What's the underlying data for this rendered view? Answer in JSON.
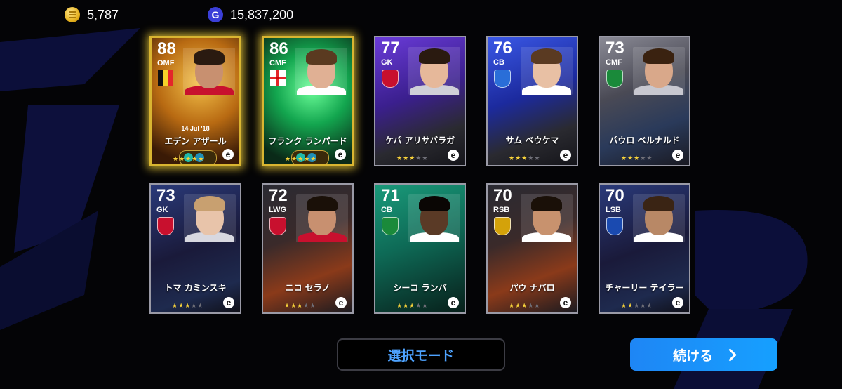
{
  "currency": {
    "coins": "5,787",
    "gp": "15,837,200",
    "gp_symbol": "G"
  },
  "cards": [
    {
      "rating": "88",
      "position": "OMF",
      "name": "エデン アザール",
      "date": "14 Jul '18",
      "stars_on": 5,
      "type": "epic-gold"
    },
    {
      "rating": "86",
      "position": "CMF",
      "name": "フランク ランパード",
      "stars_on": 5,
      "type": "epic-green"
    },
    {
      "rating": "77",
      "position": "GK",
      "name": "ケパ アリサバラガ",
      "stars_on": 3,
      "type": "purple"
    },
    {
      "rating": "76",
      "position": "CB",
      "name": "サム ベウケマ",
      "stars_on": 3,
      "type": "blue"
    },
    {
      "rating": "73",
      "position": "CMF",
      "name": "パウロ ベルナルド",
      "stars_on": 3,
      "type": "grey"
    },
    {
      "rating": "73",
      "position": "GK",
      "name": "トマ カミンスキ",
      "stars_on": 3,
      "type": "navy"
    },
    {
      "rating": "72",
      "position": "LWG",
      "name": "ニコ セラノ",
      "stars_on": 3,
      "type": "orange"
    },
    {
      "rating": "71",
      "position": "CB",
      "name": "シーコ ランバ",
      "stars_on": 3,
      "type": "teal"
    },
    {
      "rating": "70",
      "position": "RSB",
      "name": "パウ ナバロ",
      "stars_on": 3,
      "type": "orange"
    },
    {
      "rating": "70",
      "position": "LSB",
      "name": "チャーリー テイラー",
      "stars_on": 2,
      "type": "navy"
    }
  ],
  "buttons": {
    "select_mode": "選択モード",
    "continue": "続ける"
  },
  "colors": {
    "accent_blue": "#1e86f5",
    "gold_glow": "#ffdc3c",
    "star_on": "#f7d23a"
  }
}
